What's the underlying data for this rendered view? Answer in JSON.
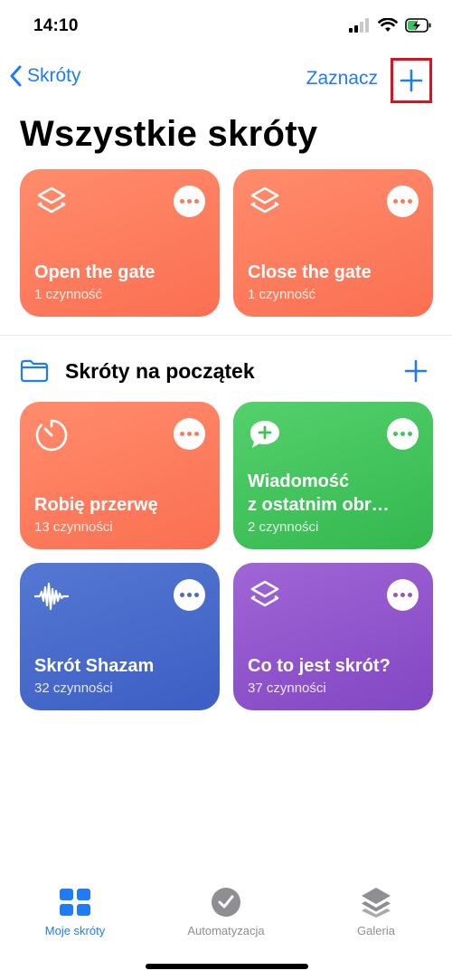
{
  "status": {
    "time": "14:10"
  },
  "nav": {
    "back_label": "Skróty",
    "select_label": "Zaznacz"
  },
  "page_title": "Wszystkie skróty",
  "top_shortcuts": [
    {
      "title": "Open the gate",
      "subtitle": "1 czynność",
      "color": "#fb7a5c",
      "icon": "layers-icon"
    },
    {
      "title": "Close the gate",
      "subtitle": "1 czynność",
      "color": "#fb7a5c",
      "icon": "layers-icon"
    }
  ],
  "folder": {
    "title": "Skróty na początek"
  },
  "folder_shortcuts": [
    {
      "title": "Robię przerwę",
      "subtitle": "13 czynności",
      "color": "#fb7a5c",
      "icon": "timer-icon"
    },
    {
      "title": "Wiadomość\nz ostatnim obr…",
      "subtitle": "2 czynności",
      "color": "#3ec45a",
      "icon": "message-plus-icon"
    },
    {
      "title": "Skrót Shazam",
      "subtitle": "32 czynności",
      "color": "#476bcc",
      "icon": "waveform-icon"
    },
    {
      "title": "Co to jest skrót?",
      "subtitle": "37 czynności",
      "color": "#8f55cc",
      "icon": "layers-icon"
    }
  ],
  "tabs": [
    {
      "label": "Moje skróty",
      "icon": "grid-icon",
      "active": true
    },
    {
      "label": "Automatyzacja",
      "icon": "clock-check-icon",
      "active": false
    },
    {
      "label": "Galeria",
      "icon": "stack-icon",
      "active": false
    }
  ],
  "colors": {
    "accent": "#1f7cf5",
    "highlight_box": "#e2101a",
    "inactive_tab": "#8e8e93"
  }
}
